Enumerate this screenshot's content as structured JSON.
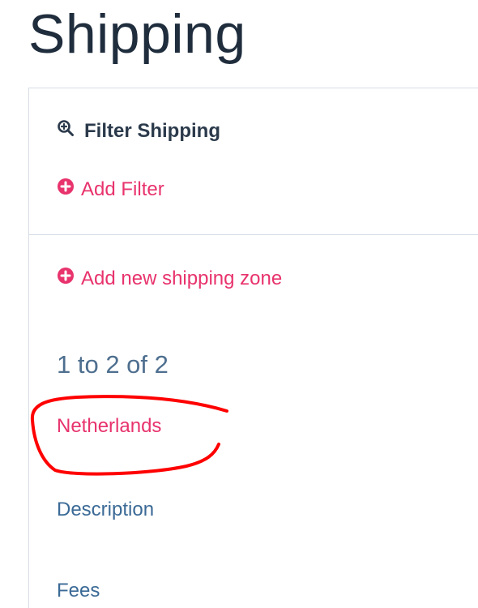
{
  "page": {
    "title": "Shipping"
  },
  "filter": {
    "heading": "Filter Shipping",
    "add_filter_label": "Add Filter"
  },
  "zones": {
    "add_zone_label": "Add new shipping zone",
    "pagination": "1 to 2 of 2",
    "items": [
      {
        "name": "Netherlands",
        "fields": [
          "Description",
          "Fees"
        ]
      }
    ]
  },
  "colors": {
    "title": "#1f2d3d",
    "link": "#e8336d",
    "muted": "#4e6f8f",
    "annotation": "#ff0000",
    "border": "#d6dde5"
  },
  "icons": {
    "filter": "zoom-in-icon",
    "add": "plus-circle-icon"
  }
}
